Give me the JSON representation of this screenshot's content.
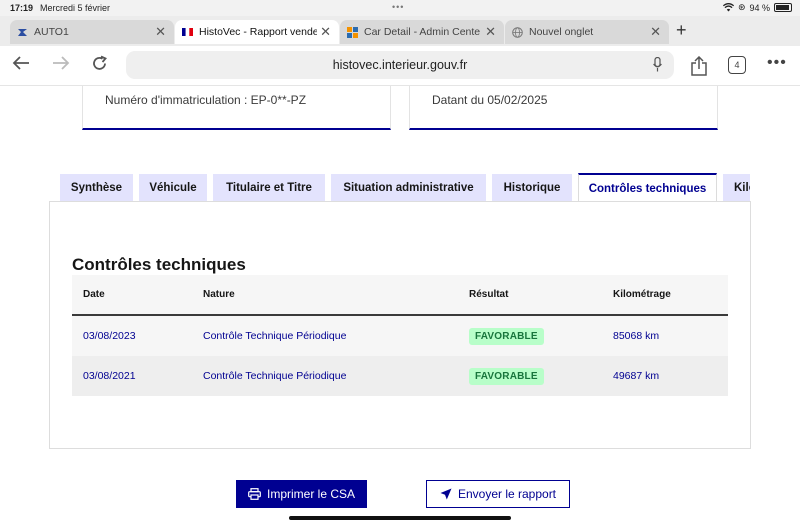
{
  "status_bar": {
    "time": "17:19",
    "date": "Mercredi 5 février",
    "battery": "94 %",
    "battery_level": 0.94
  },
  "browser": {
    "tabs": [
      {
        "title": "AUTO1",
        "icon": "auto1-favicon",
        "active": false
      },
      {
        "title": "HistoVec - Rapport vende",
        "icon": "french-flag-favicon",
        "active": true
      },
      {
        "title": "Car Detail - Admin Cente",
        "icon": "admin-favicon",
        "active": false
      },
      {
        "title": "Nouvel onglet",
        "icon": "globe-icon",
        "active": false
      }
    ],
    "url": "histovec.interieur.gouv.fr",
    "tab_count": "4"
  },
  "cards": {
    "registration": "Numéro d'immatriculation : EP-0**-PZ",
    "date": "Datant du 05/02/2025"
  },
  "site_tabs": [
    {
      "label": "Synthèse",
      "active": false
    },
    {
      "label": "Véhicule",
      "active": false
    },
    {
      "label": "Titulaire et Titre",
      "active": false
    },
    {
      "label": "Situation administrative",
      "active": false
    },
    {
      "label": "Historique",
      "active": false
    },
    {
      "label": "Contrôles techniques",
      "active": true
    },
    {
      "label": "Kilo",
      "active": false
    }
  ],
  "section": {
    "title": "Contrôles techniques",
    "columns": [
      "Date",
      "Nature",
      "Résultat",
      "Kilométrage"
    ],
    "rows": [
      {
        "date": "03/08/2023",
        "nature": "Contrôle Technique Périodique",
        "result": "FAVORABLE",
        "mileage": "85068 km"
      },
      {
        "date": "03/08/2021",
        "nature": "Contrôle Technique Périodique",
        "result": "FAVORABLE",
        "mileage": "49687 km"
      }
    ]
  },
  "actions": {
    "print_label": "Imprimer le CSA",
    "send_label": "Envoyer le rapport"
  },
  "colors": {
    "primary": "#000091",
    "tab_bg": "#e3e3fd",
    "badge_bg": "#b8fec9",
    "badge_text": "#18753c"
  }
}
